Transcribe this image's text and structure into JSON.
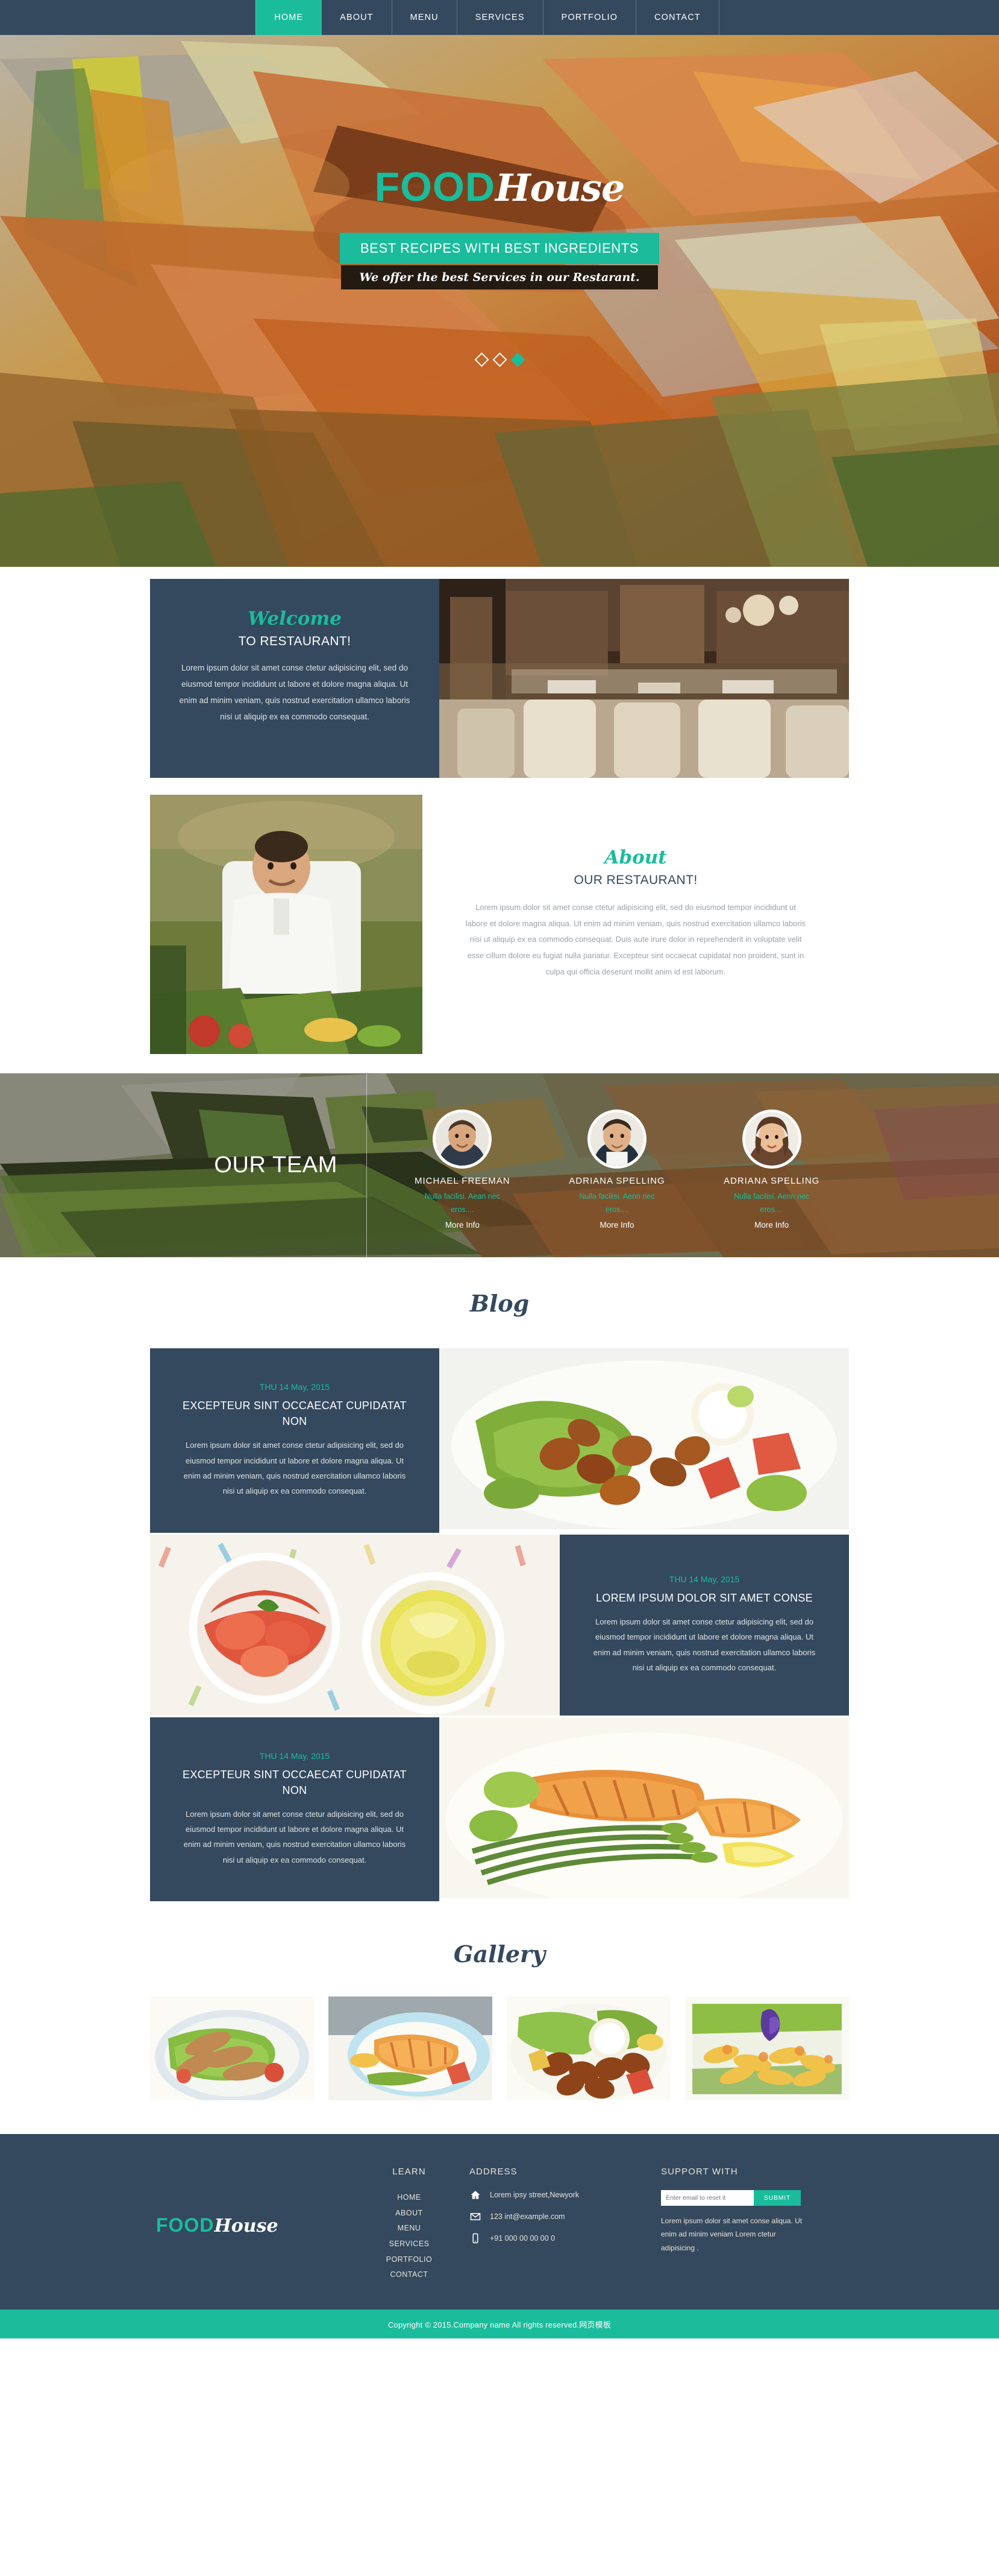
{
  "nav": {
    "items": [
      {
        "label": "HOME",
        "active": true
      },
      {
        "label": "ABOUT",
        "active": false
      },
      {
        "label": "MENU",
        "active": false
      },
      {
        "label": "SERVICES",
        "active": false
      },
      {
        "label": "PORTFOLIO",
        "active": false
      },
      {
        "label": "CONTACT",
        "active": false
      }
    ]
  },
  "hero": {
    "logo_food": "FOOD",
    "logo_house": "House",
    "tagline": "BEST RECIPES WITH BEST INGREDIENTS",
    "subtitle": "We offer the best Services in our Restarant.",
    "slides": [
      {
        "active": false
      },
      {
        "active": false
      },
      {
        "active": true
      }
    ]
  },
  "welcome": {
    "script_title": "Welcome",
    "heading": "TO RESTAURANT!",
    "body": "Lorem ipsum dolor sit amet conse ctetur adipisicing elit, sed do eiusmod tempor incididunt ut labore et dolore magna aliqua. Ut enim ad minim veniam, quis nostrud exercitation ullamco laboris nisi ut aliquip ex ea commodo consequat.",
    "image_alt": "restaurant-interior-photo"
  },
  "about": {
    "script_title": "About",
    "heading": "OUR RESTAURANT!",
    "body": "Lorem ipsum dolor sit amet conse ctetur adipisicing elit, sed do eiusmod tempor incididunt ut labore et dolore magna aliqua. Ut enim ad minim veniam, quis nostrud exercitation ullamco laboris nisi ut aliquip ex ea commodo consequat. Duis aute irure dolor in reprehenderit in voluptate velit esse cillum dolore eu fugiat nulla pariatur. Excepteur sint occaecat cupidatat non proident, sunt in culpa qui officia deserunt mollit anim id est laborum.",
    "image_alt": "chef-portrait-photo"
  },
  "team": {
    "title": "OUR TEAM",
    "members": [
      {
        "name": "MICHAEL FREEMAN",
        "desc": "Nulla facilisi. Aean nec eros....",
        "more": "More Info"
      },
      {
        "name": "ADRIANA SPELLING",
        "desc": "Nulla facilisi. Aenn nec eros....",
        "more": "More Info"
      },
      {
        "name": "ADRIANA SPELLING",
        "desc": "Nulla facilisi. Aenn nec eros....",
        "more": "More Info"
      }
    ]
  },
  "blog": {
    "script_title": "Blog",
    "posts": [
      {
        "date": "THU 14 May, 2015",
        "title": "EXCEPTEUR SINT OCCAECAT CUPIDATAT NON",
        "body": "Lorem ipsum dolor sit amet conse ctetur adipisicing elit, sed do eiusmod tempor incididunt ut labore et dolore magna aliqua. Ut enim ad minim veniam, quis nostrud exercitation ullamco laboris nisi ut aliquip ex ea commodo consequat.",
        "image_alt": "kebab-salad-photo",
        "layout": "text-left"
      },
      {
        "date": "THU 14 May, 2015",
        "title": "LOREM IPSUM DOLOR SIT AMET CONSE",
        "body": "Lorem ipsum dolor sit amet conse ctetur adipisicing elit, sed do eiusmod tempor incididunt ut labore et dolore magna aliqua. Ut enim ad minim veniam, quis nostrud exercitation ullamco laboris nisi ut aliquip ex ea commodo consequat.",
        "image_alt": "tomato-lemon-plates-photo",
        "layout": "text-right"
      },
      {
        "date": "THU 14 May, 2015",
        "title": "EXCEPTEUR SINT OCCAECAT CUPIDATAT NON",
        "body": "Lorem ipsum dolor sit amet conse ctetur adipisicing elit, sed do eiusmod tempor incididunt ut labore et dolore magna aliqua. Ut enim ad minim veniam, quis nostrud exercitation ullamco laboris nisi ut aliquip ex ea commodo consequat.",
        "image_alt": "salmon-asparagus-photo",
        "layout": "text-left"
      }
    ]
  },
  "gallery": {
    "script_title": "Gallery",
    "items": [
      {
        "alt": "grilled-chicken-salad-thumb"
      },
      {
        "alt": "grilled-fish-plate-thumb"
      },
      {
        "alt": "meat-skewer-salad-thumb"
      },
      {
        "alt": "flower-garnish-salad-thumb"
      }
    ]
  },
  "footer": {
    "logo_food": "FOOD",
    "logo_house": "House",
    "learn": {
      "heading": "LEARN",
      "links": [
        "HOME",
        "ABOUT",
        "MENU",
        "SERVICES",
        "PORTFOLIO",
        "CONTACT"
      ]
    },
    "address": {
      "heading": "ADDRESS",
      "street": "Lorem ipsy street,Newyork",
      "email": "123 int@example.com",
      "phone": "+91 000 00 00 00 0",
      "street_icon": "home-icon",
      "email_icon": "envelope-icon",
      "phone_icon": "mobile-icon"
    },
    "support": {
      "heading": "SUPPORT WITH",
      "input_placeholder": "Enter email to reset it",
      "submit_label": "SUBMIT",
      "text": "Lorem ipsum dolor sit amet conse aliqua. Ut enim ad minim veniam Lorem ctetur adipisicing ."
    },
    "copyright": "Copyright © 2015.Company name All rights reserved.网页模板"
  },
  "colors": {
    "accent": "#1abc9c",
    "dark": "#34495e",
    "white": "#ffffff"
  }
}
